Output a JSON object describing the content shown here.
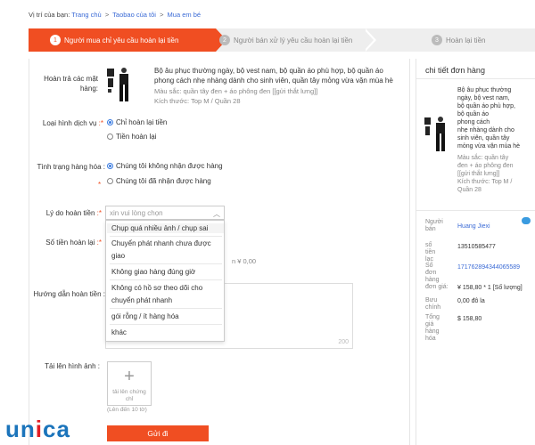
{
  "breadcrumb": {
    "prefix": "Vị trí của bạn:",
    "items": [
      "Trang chủ",
      "Taobao của tôi",
      "Mua em bé"
    ],
    "sep": ">"
  },
  "steps": [
    {
      "num": "1",
      "label": "Người mua chỉ yêu cầu hoàn lại tiền"
    },
    {
      "num": "2",
      "label": "Người bán xử lý yêu cầu hoàn lại tiền"
    },
    {
      "num": "3",
      "label": "Hoàn lại tiền"
    }
  ],
  "form": {
    "product_label_1": "Hoàn trả các mặt",
    "product_label_2": "hàng:",
    "product_desc_1": "Bộ âu phục thường ngày, bộ vest nam, bộ quần áo phù hợp, bộ quần áo",
    "product_desc_2": "phong cách nhẹ nhàng dành cho sinh viên, quần tây mỏng vừa vặn mùa hè",
    "product_color": "Màu sắc: quần tây đen + áo phông đen [[gửi thắt lưng]]",
    "product_size": "Kích thước: Top M / Quần 28",
    "service_label": "Loại hình dịch vụ",
    "service_options": [
      "Chỉ hoàn lại tiền",
      "Tiền hoàn lại"
    ],
    "status_label": "Tình trạng hàng hóa",
    "status_options": [
      "Chúng tôi không nhận được hàng",
      "Chúng tôi đã nhận được hàng"
    ],
    "reason_label": "Lý do hoàn tiền",
    "reason_placeholder": "xin vui lòng chọn",
    "reason_options": [
      "Chụp quá nhiều ảnh / chụp sai",
      "Chuyển phát nhanh chưa được",
      "giao",
      "Không giao hàng đúng giờ",
      "Không có hồ sơ theo dõi cho",
      "chuyển phát nhanh",
      "gói rỗng / ít hàng hóa",
      "khác"
    ],
    "amount_label": "Số tiền hoàn lại",
    "amount_hint": "n ¥ 0,00",
    "guide_label": "Hướng dẫn hoàn tiền",
    "char_count": "200",
    "upload_label": "Tải lên hình ảnh",
    "upload_text": "tải lên chứng chỉ",
    "upload_limit": "(Lên đến 10 tờ)",
    "submit_label": "Gửi đi",
    "colon": ":",
    "required_mark": "*"
  },
  "order": {
    "title": "chi tiết đơn hàng",
    "desc_lines": [
      "Bộ âu phục thường",
      "ngày, bộ vest nam,",
      "bộ quần áo phù hợp,",
      "bộ quần áo",
      "phong cách",
      "nhẹ nhàng dành cho",
      "sinh viên, quần tây",
      "mỏng vừa vặn mùa hè"
    ],
    "meta_lines": [
      "Màu sắc: quần tây",
      "đen + áo phông đen",
      "[[gửi thắt lưng]]",
      "Kích thước: Top M /",
      "Quần 28"
    ],
    "seller_label": [
      "Người",
      "bán"
    ],
    "seller_value": "Huang Jiexi",
    "tracking_label": [
      "số",
      "tiền",
      "lạc"
    ],
    "tracking_value": "13510585477",
    "order_label": [
      "Số",
      "đơn",
      "hàng"
    ],
    "order_value": "171762894344065589",
    "price_label": "đơn giá:",
    "price_value": "¥ 158,80 * 1 [Số lượng]",
    "postage_label": [
      "Bưu",
      "chính"
    ],
    "postage_value": "0,00 đô la",
    "total_label": [
      "Tổng",
      "giá",
      "hàng",
      "hóa"
    ],
    "total_value": "$ 158,80"
  },
  "logo": {
    "letters": [
      "u",
      "n",
      "i",
      "c",
      "a"
    ]
  },
  "colors": {
    "accent": "#f04e22",
    "link": "#3b6bd6",
    "brand_blue": "#1b74bb",
    "brand_red": "#e31e24"
  }
}
